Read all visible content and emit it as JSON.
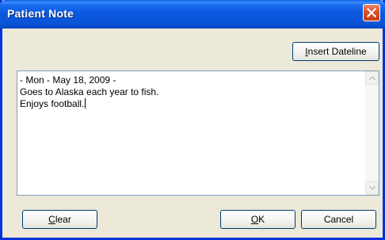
{
  "window": {
    "title": "Patient Note"
  },
  "toolbar": {
    "insert_dateline_prefix": "",
    "insert_dateline_mnemonic": "I",
    "insert_dateline_rest": "nsert Dateline"
  },
  "note": {
    "lines": [
      "- Mon - May 18, 2009 -",
      "Goes to Alaska each year to fish.",
      "Enjoys football."
    ]
  },
  "footer": {
    "clear_mnemonic": "C",
    "clear_rest": "lear",
    "ok_mnemonic": "O",
    "ok_rest": "K",
    "cancel_label": "Cancel"
  },
  "icons": {
    "close": "close-icon",
    "scroll_up": "scroll-up-arrow-icon",
    "scroll_down": "scroll-down-arrow-icon"
  },
  "colors": {
    "title_bar": "#0a54d8",
    "close_button": "#d9542a",
    "window_background": "#ece9d8"
  }
}
